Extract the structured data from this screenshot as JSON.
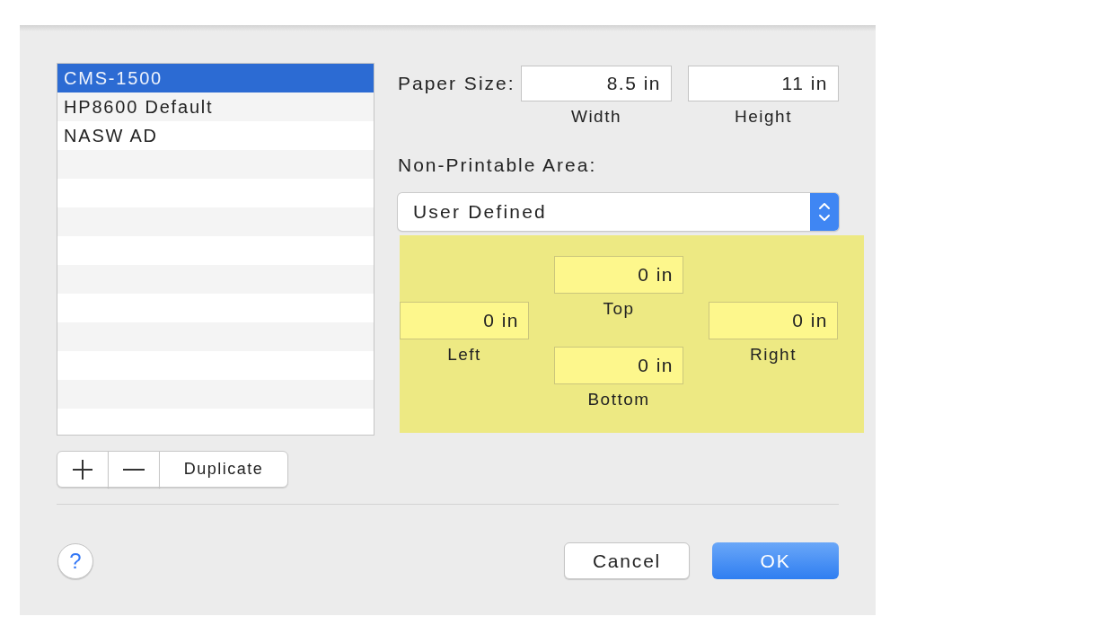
{
  "presets": {
    "items": [
      {
        "label": "CMS-1500",
        "selected": true
      },
      {
        "label": "HP8600 Default",
        "selected": false
      },
      {
        "label": "NASW AD",
        "selected": false
      }
    ]
  },
  "list_buttons": [
    {
      "kind": "add"
    },
    {
      "kind": "remove"
    },
    {
      "kind": "text",
      "label": "Duplicate"
    }
  ],
  "paper_size": {
    "label": "Paper Size:",
    "fields": [
      {
        "value": "8.5 in",
        "caption": "Width"
      },
      {
        "value": "11 in",
        "caption": "Height"
      }
    ]
  },
  "non_printable_area": {
    "label": "Non-Printable Area:",
    "dropdown": {
      "value": "User Defined"
    },
    "margins": [
      {
        "kind": "top",
        "value": "0 in",
        "caption": "Top"
      },
      {
        "kind": "left",
        "value": "0 in",
        "caption": "Left"
      },
      {
        "kind": "right",
        "value": "0 in",
        "caption": "Right"
      },
      {
        "kind": "bottom",
        "value": "0 in",
        "caption": "Bottom"
      }
    ]
  },
  "help_button": {
    "label": "?"
  },
  "buttons": [
    {
      "label": "Cancel",
      "kind": "secondary"
    },
    {
      "label": "OK",
      "kind": "primary"
    }
  ]
}
